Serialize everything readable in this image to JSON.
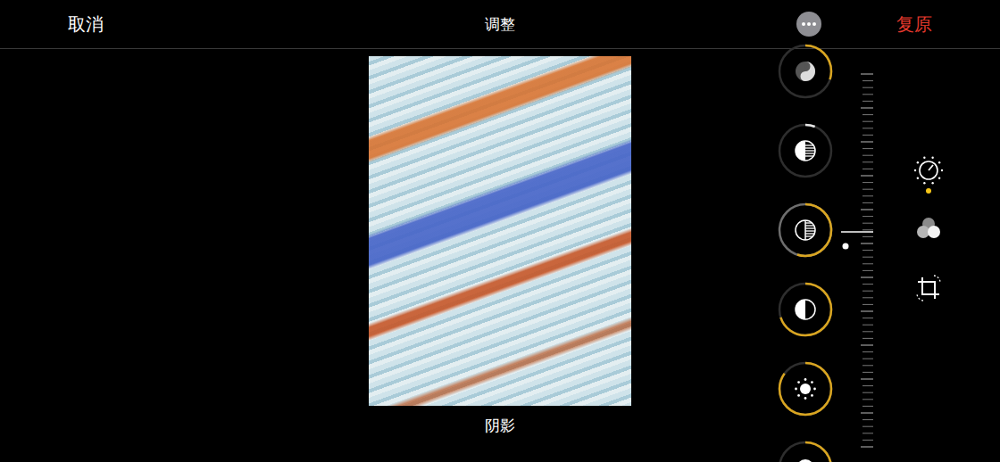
{
  "header": {
    "cancel": "取消",
    "title": "调整",
    "reset": "复原"
  },
  "photo": {
    "caption": "阴影"
  },
  "adjustments": [
    {
      "kind": "brilliance",
      "selected": false,
      "adjusted": true,
      "level": 0.3
    },
    {
      "kind": "highlights",
      "selected": false,
      "adjusted": false,
      "level": 0.06
    },
    {
      "kind": "shadows",
      "selected": true,
      "adjusted": true,
      "level": 0.55
    },
    {
      "kind": "contrast",
      "selected": false,
      "adjusted": true,
      "level": 0.7
    },
    {
      "kind": "brightness",
      "selected": false,
      "adjusted": true,
      "level": 0.85
    },
    {
      "kind": "blackpoint",
      "selected": false,
      "adjusted": true,
      "level": 0.4
    }
  ],
  "slider": {
    "level": 0.46
  },
  "tools": [
    {
      "kind": "adjust",
      "selected": true
    },
    {
      "kind": "filters",
      "selected": false
    },
    {
      "kind": "crop",
      "selected": false
    }
  ]
}
